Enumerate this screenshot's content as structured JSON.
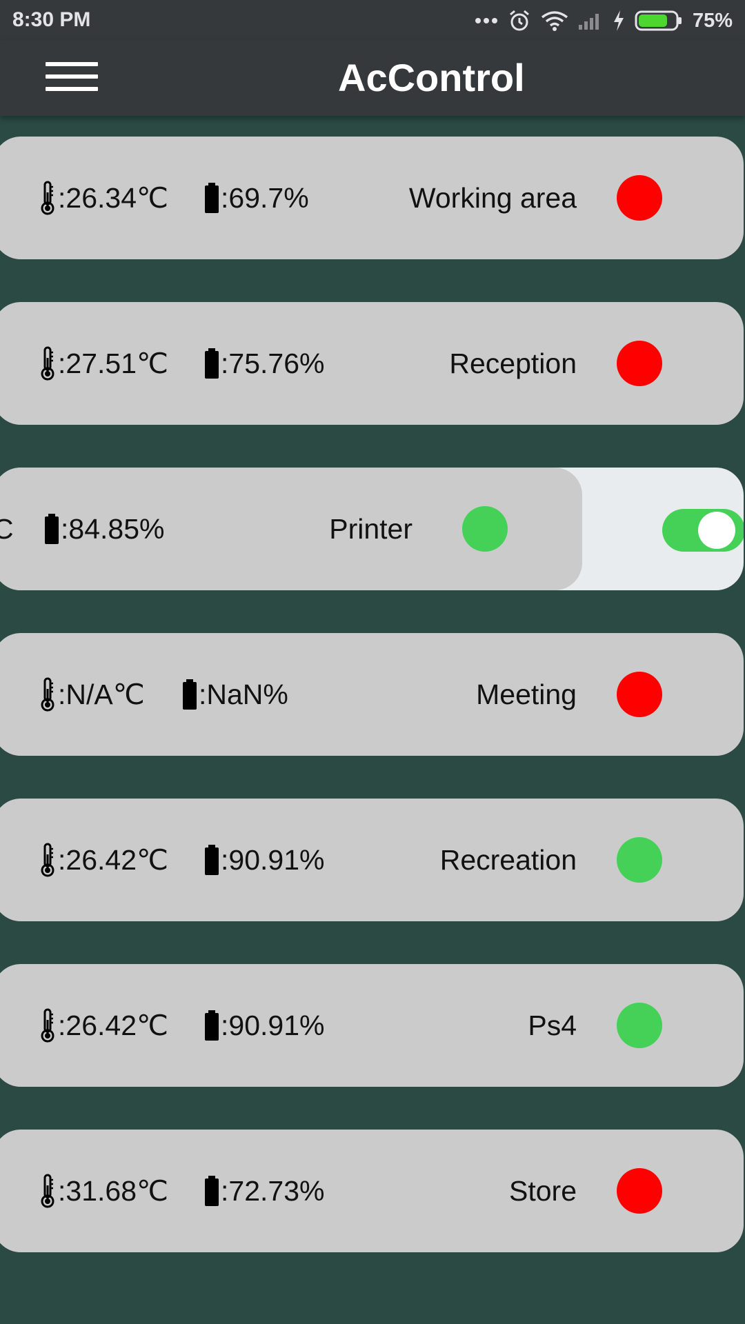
{
  "status_bar": {
    "time": "8:30 PM",
    "battery_percent": "75%",
    "icons": [
      "more-dots-icon",
      "alarm-icon",
      "wifi-icon",
      "signal-icon",
      "charging-icon",
      "battery-icon"
    ]
  },
  "app_bar": {
    "title": "AcControl",
    "menu_icon": "hamburger-menu-icon"
  },
  "colors": {
    "background": "#2b4a44",
    "card": "#cbcbcb",
    "status_on": "#45d157",
    "status_off": "#ff0000"
  },
  "rows": [
    {
      "temperature": ":26.34℃",
      "humidity": ":69.7%",
      "room": "Working area",
      "status": "off"
    },
    {
      "temperature": ":27.51℃",
      "humidity": ":75.76%",
      "room": "Reception",
      "status": "off"
    },
    {
      "temperature": "C",
      "humidity": ":84.85%",
      "room": "Printer",
      "status": "on",
      "toggle": "on"
    },
    {
      "temperature": ":N/A℃",
      "humidity": ":NaN%",
      "room": "Meeting",
      "status": "off"
    },
    {
      "temperature": ":26.42℃",
      "humidity": ":90.91%",
      "room": "Recreation",
      "status": "on"
    },
    {
      "temperature": ":26.42℃",
      "humidity": ":90.91%",
      "room": "Ps4",
      "status": "on"
    },
    {
      "temperature": ":31.68℃",
      "humidity": ":72.73%",
      "room": "Store",
      "status": "off"
    }
  ]
}
